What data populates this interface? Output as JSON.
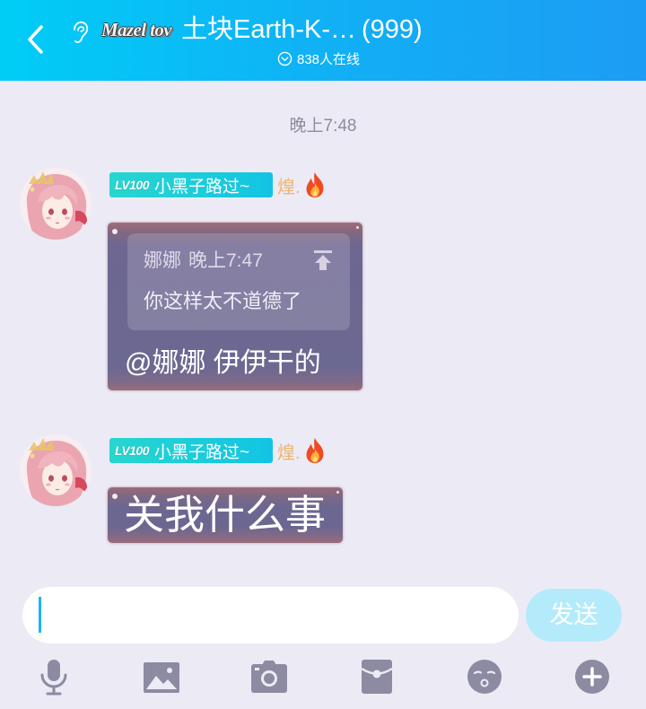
{
  "header": {
    "badge_text": "Mazel tov",
    "title": "土块Earth-K-…",
    "member_count": "(999)",
    "online_text": "838人在线",
    "icons": [
      "back-chevron-icon",
      "ear-icon",
      "chevron-down-circle-icon"
    ]
  },
  "chat": {
    "timestamp": "晚上7:48",
    "messages": [
      {
        "level": "LV100",
        "name": "小黑子路过~",
        "honor": "煌.",
        "honor_icon": "fire-icon",
        "quote": {
          "author": "娜娜",
          "time": "晚上7:47",
          "text": "你这样太不道德了",
          "icon": "jump-to-top-icon"
        },
        "text": "@娜娜 伊伊干的"
      },
      {
        "level": "LV100",
        "name": "小黑子路过~",
        "honor": "煌.",
        "honor_icon": "fire-icon",
        "text": "关我什么事"
      }
    ]
  },
  "composer": {
    "input_value": "",
    "send_label": "发送"
  },
  "toolbar": {
    "icons": [
      "mic-icon",
      "image-icon",
      "camera-icon",
      "red-packet-icon",
      "emoji-icon",
      "plus-icon"
    ]
  },
  "colors": {
    "header_gradient_start": "#00cdf6",
    "header_gradient_end": "#1c9cf4",
    "background": "#ecebf5",
    "cursor": "#1cb6ef",
    "send_button": "#b4ebfb",
    "name_badge": "#17cfd9",
    "honor_text": "#efb56c",
    "bubble": "#6c6791",
    "icon_gray": "#8d8ba2"
  }
}
